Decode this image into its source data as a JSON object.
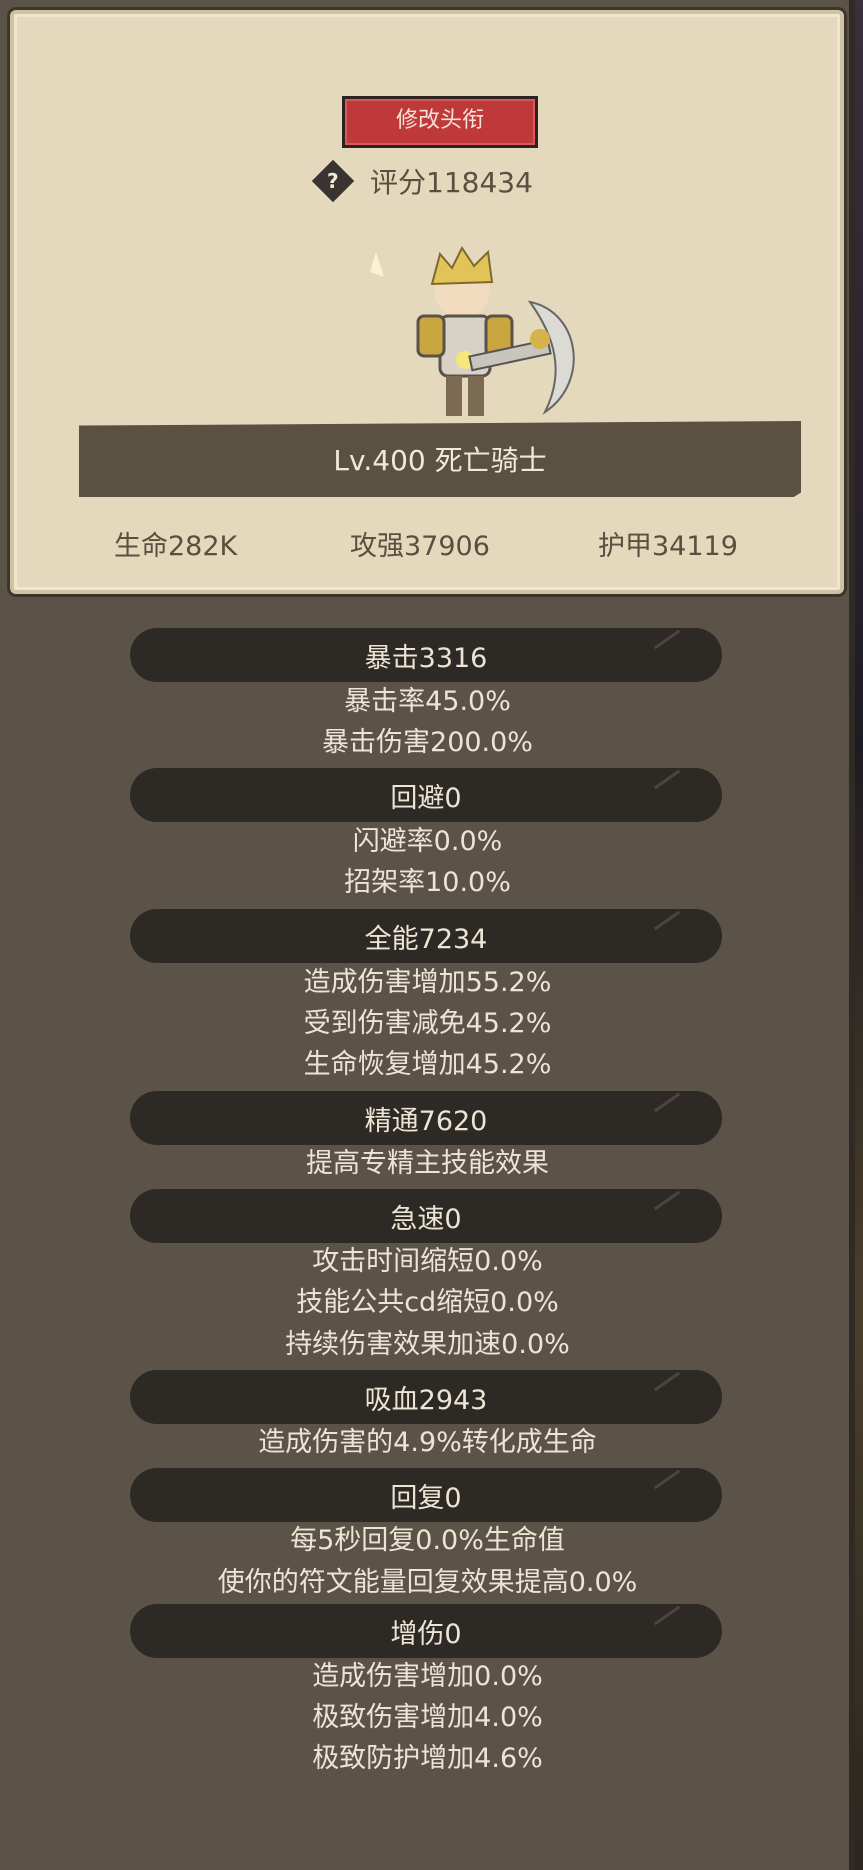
{
  "header": {
    "title_button": "修改头衔",
    "score": "评分118434",
    "help_icon": "question-diamond",
    "hero_name": "Lv.400 死亡骑士",
    "stats": {
      "hp": "生命282K",
      "attack": "攻强37906",
      "armor": "护甲34119"
    }
  },
  "groups": [
    {
      "title": "暴击3316",
      "lines": [
        "暴击率45.0%",
        "暴击伤害200.0%"
      ]
    },
    {
      "title": "回避0",
      "lines": [
        "闪避率0.0%",
        "招架率10.0%"
      ]
    },
    {
      "title": "全能7234",
      "lines": [
        "造成伤害增加55.2%",
        "受到伤害减免45.2%",
        "生命恢复增加45.2%"
      ]
    },
    {
      "title": "精通7620",
      "lines": [
        "提高专精主技能效果"
      ]
    },
    {
      "title": "急速0",
      "lines": [
        "攻击时间缩短0.0%",
        "技能公共cd缩短0.0%",
        "持续伤害效果加速0.0%"
      ]
    },
    {
      "title": "吸血2943",
      "lines": [
        "造成伤害的4.9%转化成生命"
      ]
    },
    {
      "title": "回复0",
      "lines": [
        "每5秒回复0.0%生命值",
        "使你的符文能量回复效果提高0.0%"
      ]
    },
    {
      "title": "增伤0",
      "lines": [
        "造成伤害增加0.0%",
        "极致伤害增加4.0%",
        "极致防护增加4.6%"
      ]
    }
  ],
  "colors": {
    "accent_red": "#c0393a",
    "panel": "#5b5347",
    "parchment": "#e4d9bd",
    "pill": "#2d2925"
  }
}
